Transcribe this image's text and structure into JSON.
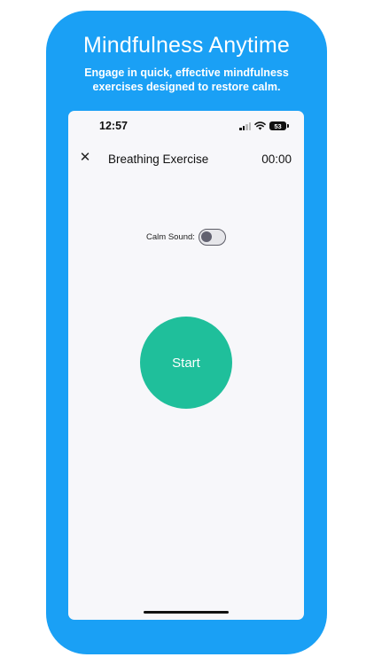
{
  "promo": {
    "headline": "Mindfulness Anytime",
    "subhead_line1": "Engage in quick, effective mindfulness",
    "subhead_line2": "exercises designed to restore calm."
  },
  "status_bar": {
    "time": "12:57",
    "battery_level": "53"
  },
  "nav": {
    "close_icon": "close-icon",
    "close_glyph": "✕",
    "title": "Breathing Exercise",
    "timer": "00:00"
  },
  "settings": {
    "calm_sound_label": "Calm Sound:",
    "calm_sound_enabled": false
  },
  "actions": {
    "start_label": "Start"
  },
  "colors": {
    "device_blue": "#1aa0f5",
    "start_green": "#1fbf9b",
    "screen_bg": "#f7f7fa"
  }
}
